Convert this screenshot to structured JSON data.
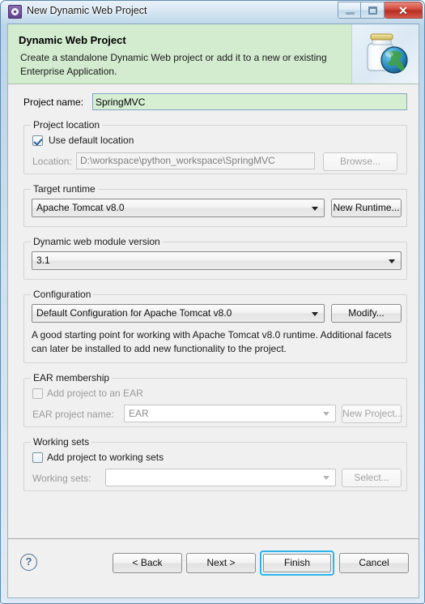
{
  "window": {
    "title": "New Dynamic Web Project",
    "icon": "project-wizard-icon",
    "minimize_label": "Minimize",
    "maximize_label": "Maximize",
    "close_label": "Close"
  },
  "banner": {
    "title": "Dynamic Web Project",
    "description": "Create a standalone Dynamic Web project or add it to a new or existing Enterprise Application.",
    "image": "jar-with-globe-icon",
    "background_color": "#d3ecd0"
  },
  "project_name": {
    "label": "Project name:",
    "value": "SpringMVC",
    "placeholder": "",
    "valid_background": "#d6eed2"
  },
  "project_location": {
    "group_label": "Project location",
    "use_default_label": "Use default location",
    "use_default_checked": true,
    "location_label": "Location:",
    "location_value": "D:\\workspace\\python_workspace\\SpringMVC",
    "browse_label": "Browse...",
    "browse_enabled": false
  },
  "target_runtime": {
    "group_label": "Target runtime",
    "selected": "Apache Tomcat v8.0",
    "new_runtime_label": "New Runtime...",
    "enabled": true
  },
  "module_version": {
    "group_label": "Dynamic web module version",
    "selected": "3.1",
    "enabled": true
  },
  "configuration": {
    "group_label": "Configuration",
    "selected": "Default Configuration for Apache Tomcat v8.0",
    "modify_label": "Modify...",
    "description": "A good starting point for working with Apache Tomcat v8.0 runtime. Additional facets can later be installed to add new functionality to the project."
  },
  "ear_membership": {
    "group_label": "EAR membership",
    "add_to_ear_label": "Add project to an EAR",
    "add_to_ear_checked": false,
    "add_to_ear_enabled": false,
    "ear_project_name_label": "EAR project name:",
    "ear_project_name_value": "EAR",
    "new_project_label": "New Project...",
    "new_project_enabled": false
  },
  "working_sets": {
    "group_label": "Working sets",
    "add_to_working_sets_label": "Add project to working sets",
    "add_to_working_sets_checked": false,
    "working_sets_label": "Working sets:",
    "working_sets_value": "",
    "select_label": "Select...",
    "select_enabled": false
  },
  "footer": {
    "help_label": "?",
    "back_label": "< Back",
    "next_label": "Next >",
    "finish_label": "Finish",
    "cancel_label": "Cancel",
    "default_button": "Finish",
    "focus_ring_color": "#2fb2e8"
  }
}
